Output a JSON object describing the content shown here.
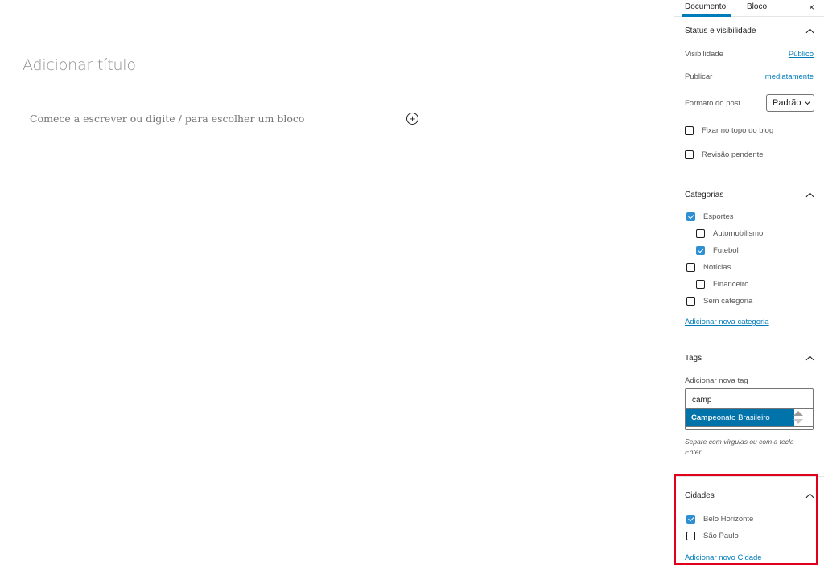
{
  "editor": {
    "title_placeholder": "Adicionar título",
    "block_placeholder": "Comece a escrever ou digite / para escolher um bloco"
  },
  "sidebar": {
    "tabs": [
      "Documento",
      "Bloco"
    ],
    "close": "×",
    "status": {
      "title": "Status e visibilidade",
      "visibility_label": "Visibilidade",
      "visibility_value": "Público",
      "publish_label": "Publicar",
      "publish_value": "Imediatamente",
      "format_label": "Formato do post",
      "format_value": "Padrão",
      "sticky_label": "Fixar no topo do blog",
      "pending_label": "Revisão pendente"
    },
    "categories": {
      "title": "Categorias",
      "items": [
        {
          "label": "Esportes",
          "checked": true,
          "level": 0
        },
        {
          "label": "Automobilismo",
          "checked": false,
          "level": 1
        },
        {
          "label": "Futebol",
          "checked": true,
          "level": 1
        },
        {
          "label": "Notícias",
          "checked": false,
          "level": 0
        },
        {
          "label": "Financeiro",
          "checked": false,
          "level": 1
        },
        {
          "label": "Sem categoria",
          "checked": false,
          "level": 0
        }
      ],
      "add_link": "Adicionar nova categoria"
    },
    "tags": {
      "title": "Tags",
      "add_label": "Adicionar nova tag",
      "input_value": "camp",
      "suggestion_match": "Camp",
      "suggestion_rest": "eonato Brasileiro",
      "help": "Separe com vírgulas ou com a tecla Enter."
    },
    "cities": {
      "title": "Cidades",
      "items": [
        {
          "label": "Belo Horizonte",
          "checked": true
        },
        {
          "label": "São Paulo",
          "checked": false
        }
      ],
      "add_link": "Adicionar novo Cidade"
    }
  },
  "colors": {
    "accent": "#007cba",
    "highlight": "#e0001b",
    "suggestion_bg": "#0073aa"
  }
}
